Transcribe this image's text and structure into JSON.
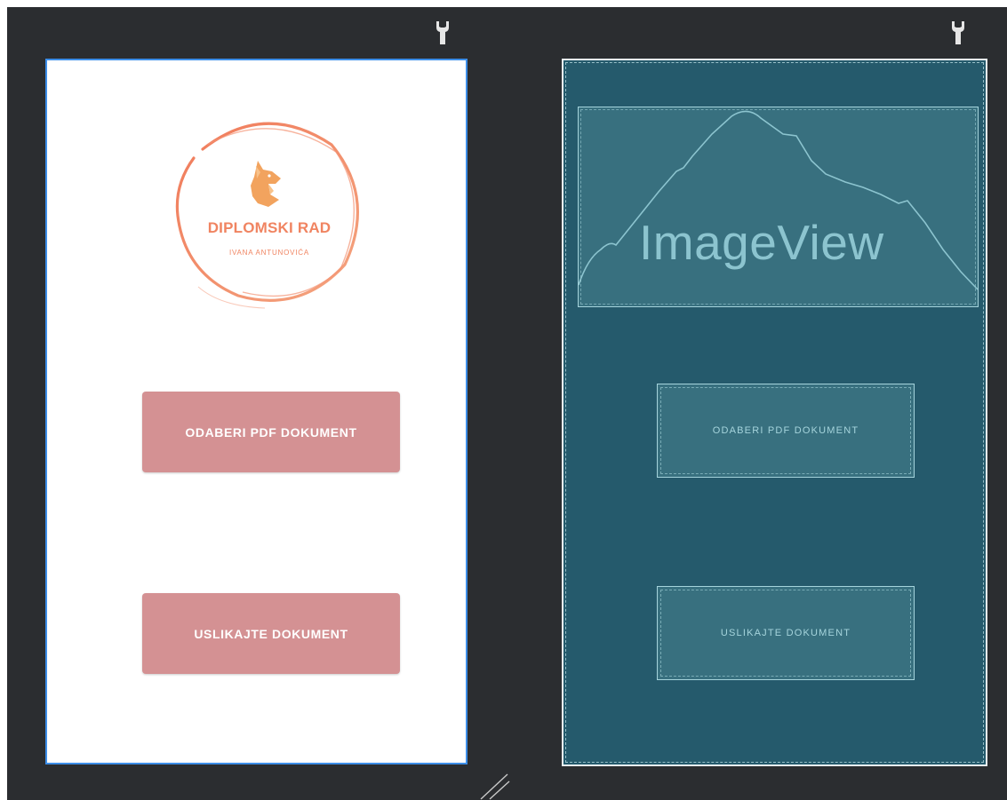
{
  "design": {
    "logo_title": "DIPLOMSKI RAD",
    "logo_subtitle": "IVANA ANTUNOVIĆA",
    "button_pick_pdf": "ODABERI PDF DOKUMENT",
    "button_capture": "USLIKAJTE DOKUMENT"
  },
  "blueprint": {
    "imageview_label": "ImageView",
    "button_pick_pdf": "ODABERI PDF DOKUMENT",
    "button_capture": "USLIKAJTE DOKUMENT"
  },
  "icons": {
    "left_toolbar": "wrench-icon",
    "right_toolbar": "wrench-icon",
    "resize": "resize-handle-icon",
    "logo": "fox-icon"
  },
  "colors": {
    "canvas_bg": "#2b2d30",
    "selection_border": "#3d8ee8",
    "logo_accent": "#f08461",
    "button_bg": "#d49193",
    "blueprint_bg": "#255a6c",
    "blueprint_element": "#38707f",
    "blueprint_line": "#a5d4dc"
  }
}
